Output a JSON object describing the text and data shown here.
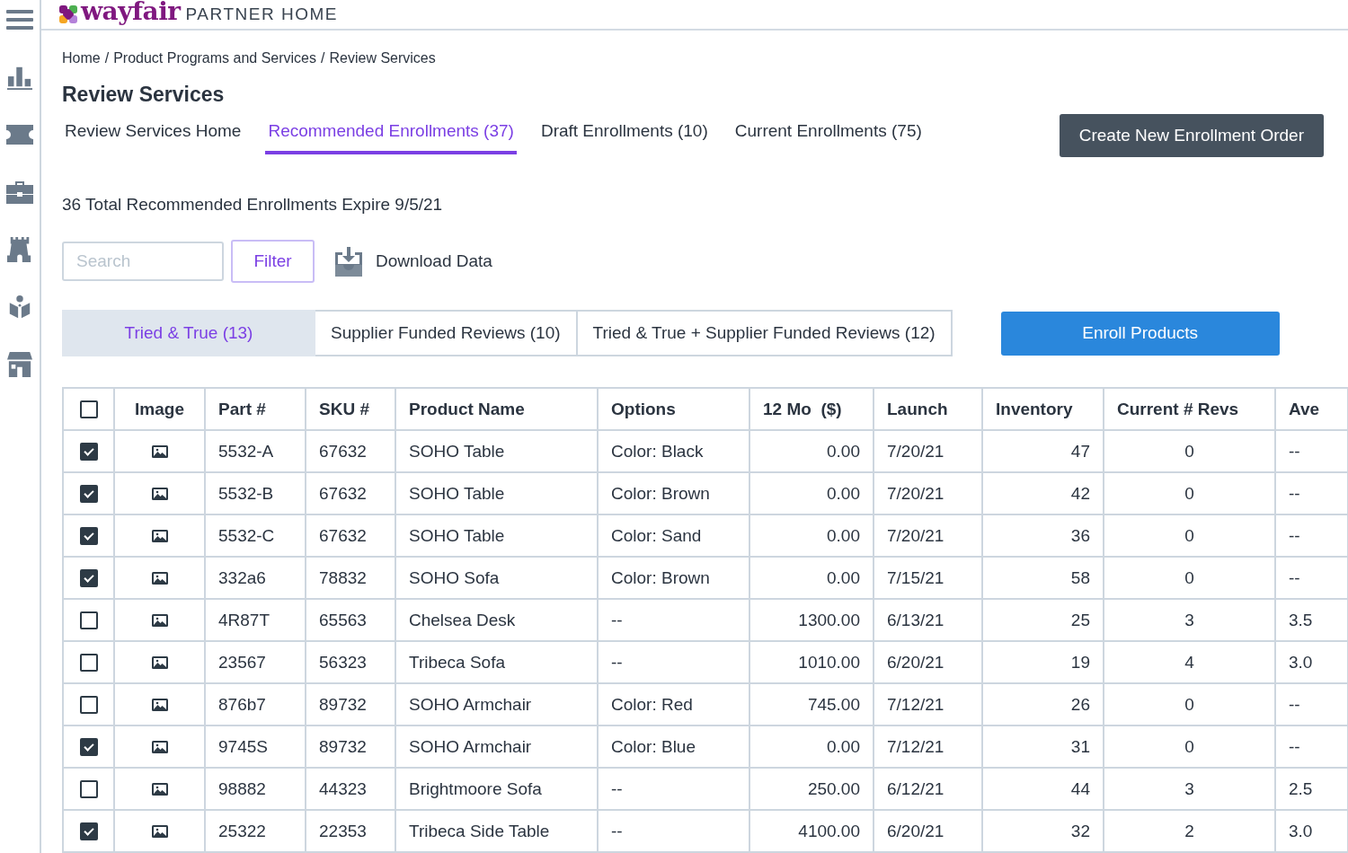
{
  "header": {
    "logo": "wayfair",
    "title": "PARTNER HOME"
  },
  "breadcrumb": {
    "separator": "/",
    "items": [
      "Home",
      "Product Programs and Services",
      "Review Services"
    ]
  },
  "page_title": "Review Services",
  "tabs": [
    {
      "label": "Review Services Home",
      "selected": false
    },
    {
      "label": "Recommended Enrollments (37)",
      "selected": true
    },
    {
      "label": "Draft Enrollments (10)",
      "selected": false
    },
    {
      "label": "Current Enrollments (75)",
      "selected": false
    }
  ],
  "create_button": "Create New Enrollment Order",
  "expiry_note": "36 Total Recommended Enrollments Expire 9/5/21",
  "search": {
    "placeholder": "Search"
  },
  "filter_button": "Filter",
  "download_label": "Download Data",
  "segments": [
    {
      "label": "Tried & True (13)",
      "selected": true
    },
    {
      "label": "Supplier Funded Reviews (10)",
      "selected": false
    },
    {
      "label": "Tried & True + Supplier Funded Reviews (12)",
      "selected": false
    }
  ],
  "enroll_button": "Enroll Products",
  "table": {
    "select_all_checked": false,
    "columns": [
      "",
      "Image",
      "Part #",
      "SKU #",
      "Product Name",
      "Options",
      "12 Mo  ($)",
      "Launch",
      "Inventory",
      "Current # Revs",
      "Ave"
    ],
    "rows": [
      {
        "checked": true,
        "cells": [
          "",
          "",
          "5532-A",
          "67632",
          "SOHO Table",
          "Color: Black",
          "0.00",
          "7/20/21",
          "47",
          "0",
          "--"
        ]
      },
      {
        "checked": true,
        "cells": [
          "",
          "",
          "5532-B",
          "67632",
          "SOHO Table",
          "Color: Brown",
          "0.00",
          "7/20/21",
          "42",
          "0",
          "--"
        ]
      },
      {
        "checked": true,
        "cells": [
          "",
          "",
          "5532-C",
          "67632",
          "SOHO Table",
          "Color: Sand",
          "0.00",
          "7/20/21",
          "36",
          "0",
          "--"
        ]
      },
      {
        "checked": true,
        "cells": [
          "",
          "",
          "332a6",
          "78832",
          "SOHO Sofa",
          "Color: Brown",
          "0.00",
          "7/15/21",
          "58",
          "0",
          "--"
        ]
      },
      {
        "checked": false,
        "cells": [
          "",
          "",
          "4R87T",
          "65563",
          "Chelsea Desk",
          "--",
          "1300.00",
          "6/13/21",
          "25",
          "3",
          "3.5"
        ]
      },
      {
        "checked": false,
        "cells": [
          "",
          "",
          "23567",
          "56323",
          "Tribeca Sofa",
          "--",
          "1010.00",
          "6/20/21",
          "19",
          "4",
          "3.0"
        ]
      },
      {
        "checked": false,
        "cells": [
          "",
          "",
          "876b7",
          "89732",
          "SOHO Armchair",
          "Color: Red",
          "745.00",
          "7/12/21",
          "26",
          "0",
          "--"
        ]
      },
      {
        "checked": true,
        "cells": [
          "",
          "",
          "9745S",
          "89732",
          "SOHO Armchair",
          "Color: Blue",
          "0.00",
          "7/12/21",
          "31",
          "0",
          "--"
        ]
      },
      {
        "checked": false,
        "cells": [
          "",
          "",
          "98882",
          "44323",
          "Brightmoore Sofa",
          "--",
          "250.00",
          "6/12/21",
          "44",
          "3",
          "2.5"
        ]
      },
      {
        "checked": true,
        "cells": [
          "",
          "",
          "25322",
          "22353",
          "Tribeca Side Table",
          "--",
          "4100.00",
          "6/20/21",
          "32",
          "2",
          "3.0"
        ]
      }
    ]
  }
}
